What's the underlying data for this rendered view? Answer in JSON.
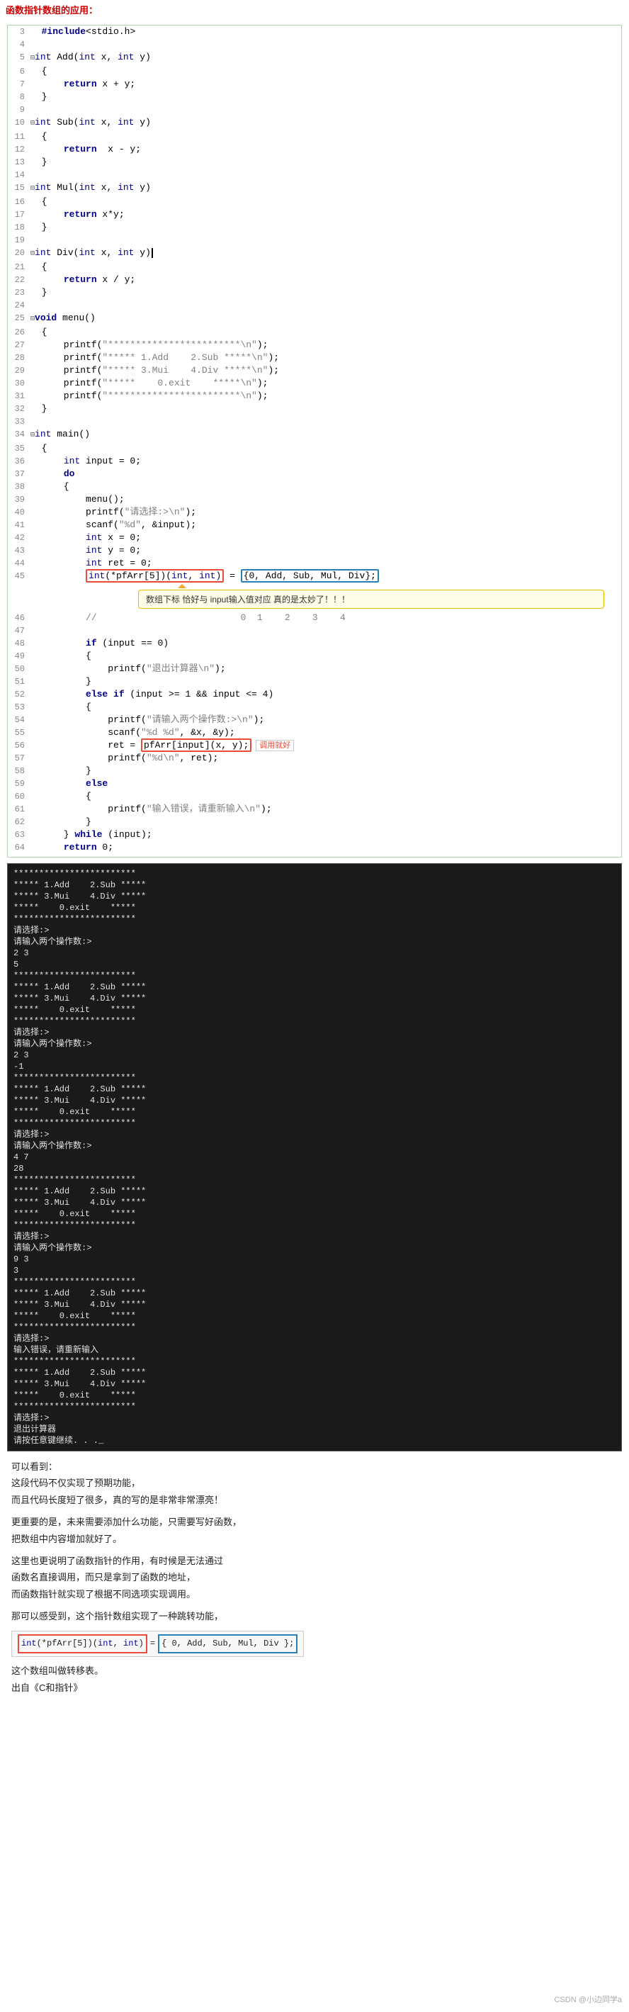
{
  "page": {
    "title": "函数指针数组的应用",
    "watermark": "CSDN @小边同学a"
  },
  "code_title": "函数指针数组的应用：",
  "code_lines": [
    {
      "num": "3",
      "content": "  #include<stdio.h>",
      "type": "include"
    },
    {
      "num": "4",
      "content": "",
      "type": "blank"
    },
    {
      "num": "5",
      "content": "=int Add(int x, int y)",
      "type": "func"
    },
    {
      "num": "6",
      "content": "  {",
      "type": "brace"
    },
    {
      "num": "7",
      "content": "      return x + y;",
      "type": "stmt"
    },
    {
      "num": "8",
      "content": "  }",
      "type": "brace"
    },
    {
      "num": "9",
      "content": "",
      "type": "blank"
    },
    {
      "num": "10",
      "content": "=int Sub(int x, int y)",
      "type": "func"
    },
    {
      "num": "11",
      "content": "  {",
      "type": "brace"
    },
    {
      "num": "12",
      "content": "      return  x - y;",
      "type": "stmt"
    },
    {
      "num": "13",
      "content": "  }",
      "type": "brace"
    },
    {
      "num": "14",
      "content": "",
      "type": "blank"
    },
    {
      "num": "15",
      "content": "=int Mul(int x, int y)",
      "type": "func"
    },
    {
      "num": "16",
      "content": "  {",
      "type": "brace"
    },
    {
      "num": "17",
      "content": "      return x*y;",
      "type": "stmt"
    },
    {
      "num": "18",
      "content": "  }",
      "type": "brace"
    },
    {
      "num": "19",
      "content": "",
      "type": "blank"
    },
    {
      "num": "20",
      "content": "=int Div(int x, int y)",
      "type": "func",
      "cursor": true
    },
    {
      "num": "21",
      "content": "  {",
      "type": "brace"
    },
    {
      "num": "22",
      "content": "      return x / y;",
      "type": "stmt"
    },
    {
      "num": "23",
      "content": "  }",
      "type": "brace"
    },
    {
      "num": "24",
      "content": "",
      "type": "blank"
    },
    {
      "num": "25",
      "content": "=void menu()",
      "type": "func"
    },
    {
      "num": "26",
      "content": "  {",
      "type": "brace"
    },
    {
      "num": "27",
      "content": "      printf(\"************************\\n\");",
      "type": "stmt"
    },
    {
      "num": "28",
      "content": "      printf(\"***** 1.Add    2.Sub *****\\n\");",
      "type": "stmt"
    },
    {
      "num": "29",
      "content": "      printf(\"***** 3.Mui    4.Div *****\\n\");",
      "type": "stmt"
    },
    {
      "num": "30",
      "content": "      printf(\"*****    0.exit    *****\\n\");",
      "type": "stmt"
    },
    {
      "num": "31",
      "content": "      printf(\"************************\\n\");",
      "type": "stmt"
    },
    {
      "num": "32",
      "content": "  }",
      "type": "brace"
    },
    {
      "num": "33",
      "content": "",
      "type": "blank"
    },
    {
      "num": "34",
      "content": "=int main()",
      "type": "func"
    },
    {
      "num": "35",
      "content": "  {",
      "type": "brace"
    },
    {
      "num": "36",
      "content": "      int input = 0;",
      "type": "stmt"
    },
    {
      "num": "37",
      "content": "      do",
      "type": "stmt"
    },
    {
      "num": "38",
      "content": "      {",
      "type": "brace"
    },
    {
      "num": "39",
      "content": "          menu();",
      "type": "stmt"
    },
    {
      "num": "40",
      "content": "          printf(\"请选择:>\\n\");",
      "type": "stmt"
    },
    {
      "num": "41",
      "content": "          scanf(\"%d\", &input);",
      "type": "stmt"
    },
    {
      "num": "42",
      "content": "          int x = 0;",
      "type": "stmt"
    },
    {
      "num": "43",
      "content": "          int y = 0;",
      "type": "stmt"
    },
    {
      "num": "44",
      "content": "          int ret = 0;",
      "type": "stmt"
    },
    {
      "num": "45",
      "content": "          int(*pfArr[5])(int, int) = {0, Add, Sub, Mul, Div};",
      "type": "stmt_special"
    },
    {
      "num": "46",
      "content": "          //                          0  1    2    3    4",
      "type": "comment"
    },
    {
      "num": "47",
      "content": "",
      "type": "blank"
    },
    {
      "num": "48",
      "content": "          if (input == 0)",
      "type": "stmt"
    },
    {
      "num": "49",
      "content": "          {",
      "type": "brace"
    },
    {
      "num": "50",
      "content": "              printf(\"退出计算器\\n\");",
      "type": "stmt"
    },
    {
      "num": "51",
      "content": "          }",
      "type": "brace"
    },
    {
      "num": "52",
      "content": "          else if (input >= 1 && input <= 4)",
      "type": "stmt"
    },
    {
      "num": "53",
      "content": "          {",
      "type": "brace"
    },
    {
      "num": "54",
      "content": "              printf(\"请输入两个操作数:>\\n\");",
      "type": "stmt"
    },
    {
      "num": "55",
      "content": "              scanf(\"%d %d\", &x, &y);",
      "type": "stmt"
    },
    {
      "num": "56",
      "content": "              ret = pfArr[input](x, y);",
      "type": "stmt_special2"
    },
    {
      "num": "57",
      "content": "              printf(\"%d\\n\", ret);",
      "type": "stmt"
    },
    {
      "num": "58",
      "content": "          }",
      "type": "brace"
    },
    {
      "num": "59",
      "content": "          else",
      "type": "stmt"
    },
    {
      "num": "60",
      "content": "          {",
      "type": "brace"
    },
    {
      "num": "61",
      "content": "              printf(\"输入错误，请重新输入\\n\");",
      "type": "stmt"
    },
    {
      "num": "62",
      "content": "          }",
      "type": "brace"
    },
    {
      "num": "63",
      "content": "      } while (input);",
      "type": "stmt"
    },
    {
      "num": "64",
      "content": "      return 0;",
      "type": "stmt"
    }
  ],
  "terminal": {
    "blocks": [
      "************************\n***** 1.Add    2.Sub *****\n***** 3.Mui    4.Div *****\n*****    0.exit    *****\n************************\n请选择:>\n\n请输入两个操作数:>\n2 3\n5",
      "************************\n***** 1.Add    2.Sub *****\n***** 3.Mui    4.Div *****\n*****    0.exit    *****\n************************\n请选择:>\n\n请输入两个操作数:>\n2 3\n-1",
      "************************\n***** 1.Add    2.Sub *****\n***** 3.Mui    4.Div *****\n*****    0.exit    *****\n************************\n请选择:>\n\n请输入两个操作数:>\n4 7\n28",
      "************************\n***** 1.Add    2.Sub *****\n***** 3.Mui    4.Div *****\n*****    0.exit    *****\n************************\n请选择:>\n\n请输入两个操作数:>\n9 3\n3",
      "************************\n***** 1.Add    2.Sub *****\n***** 3.Mui    4.Div *****\n*****    0.exit    *****\n************************\n请选择:>\n输入错误，请重新输入\n************************\n***** 1.Add    2.Sub *****\n***** 3.Mui    4.Div *****\n*****    0.exit    *****\n************************\n请选择:>\n\n退出计算器\n请按任意键继续. . ._"
    ]
  },
  "commentary": {
    "can_see": "可以看到：",
    "para1": "这段代码不仅实现了预期功能，",
    "para2": "而且代码长度短了很多，真的写的是非常非常漂亮！",
    "para3": "更重要的是，未来需要添加什么功能，只需要写好函数，",
    "para4": "把数组中内容增加就好了。",
    "para5": "这里也更说明了函数指针的作用，有时候是无法通过",
    "para6": "函数名直接调用，而只是拿到了函数的地址，",
    "para7": "而函数指针就实现了根据不同选项实现调用。",
    "para8": "那可以感受到，这个指针数组实现了一种跳转功能，",
    "jump_table_label": "这个数组叫做转移表。",
    "source": "出自《C和指针》"
  },
  "inline_code_display": "int(*pfArr[5])(int, int) = { 0, Add, Sub, Mul, Div };",
  "annotation_text": "数组下标 恰好与 input输入值对应\n真的是太妙了！！！",
  "call_annotation_text": "调用就好"
}
